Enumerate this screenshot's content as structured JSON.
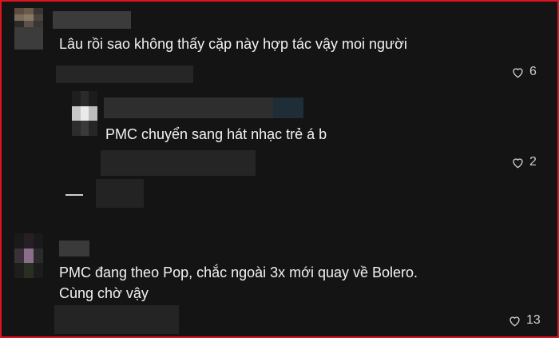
{
  "comments": [
    {
      "text": "Lâu rồi sao không thấy cặp này hợp tác vậy moi người",
      "likes": "6",
      "icon": "heart-outline-icon"
    },
    {
      "text": "PMC chuyển sang hát nhạc trẻ á b",
      "likes": "2",
      "icon": "heart-outline-icon"
    },
    {
      "text_line1": "PMC đang theo Pop, chắc ngoài 3x mới quay về Bolero.",
      "text_line2": "Cùng chờ vậy",
      "likes": "13",
      "icon": "heart-outline-icon"
    }
  ],
  "colors": {
    "background": "#141414",
    "border": "#e0141e",
    "text": "#f2f2f2",
    "muted": "#cfcfcf"
  }
}
